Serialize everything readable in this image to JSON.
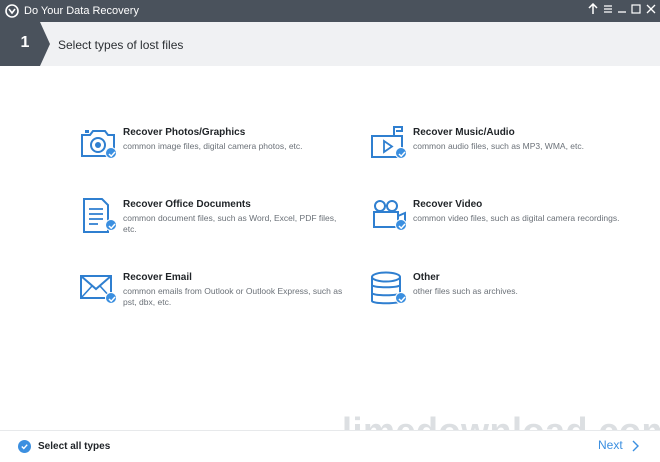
{
  "window": {
    "title": "Do Your Data Recovery",
    "controls": [
      "upload-icon",
      "menu-icon",
      "minimize-icon",
      "maximize-icon",
      "close-icon"
    ]
  },
  "step": {
    "number": "1",
    "title": "Select types of lost files"
  },
  "options": [
    {
      "title": "Recover Photos/Graphics",
      "desc": "common image files, digital camera photos, etc.",
      "icon": "camera-icon",
      "checked": true
    },
    {
      "title": "Recover Music/Audio",
      "desc": "common audio files, such as MP3, WMA, etc.",
      "icon": "music-icon",
      "checked": true
    },
    {
      "title": "Recover Office Documents",
      "desc": "common document files, such as Word, Excel, PDF files, etc.",
      "icon": "document-icon",
      "checked": true
    },
    {
      "title": "Recover Video",
      "desc": "common video files, such as digital camera recordings.",
      "icon": "video-camera-icon",
      "checked": true
    },
    {
      "title": "Recover Email",
      "desc": "common emails from Outlook or Outlook Express, such as pst, dbx, etc.",
      "icon": "envelope-icon",
      "checked": true
    },
    {
      "title": "Other",
      "desc": "other files such as archives.",
      "icon": "database-icon",
      "checked": true
    }
  ],
  "footer": {
    "select_all": "Select all types",
    "next": "Next",
    "watermark": "limedownload.com"
  },
  "colors": {
    "titlebar": "#4a525c",
    "accent": "#3b8fe0",
    "icon_blue": "#2f7fd0"
  }
}
